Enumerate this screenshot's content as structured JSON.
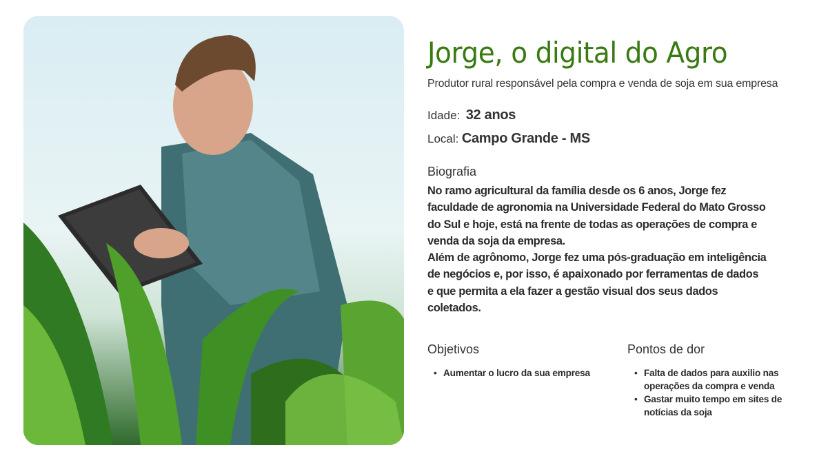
{
  "persona": {
    "title": "Jorge, o digital do Agro",
    "subtitle": "Produtor rural responsável pela compra e venda de soja em sua empresa",
    "age_label": "Idade:",
    "age_value": "32 anos",
    "location_label": "Local:",
    "location_value": "Campo Grande - MS",
    "bio_heading": "Biografia",
    "bio_lines": [
      "No ramo agricultural da família desde os 6 anos, Jorge fez",
      "faculdade de agronomia na Universidade Federal do Mato Grosso",
      "do Sul e hoje, está na frente de todas as operações de compra e",
      "venda da soja da empresa.",
      "Além de agrônomo, Jorge fez uma pós-graduação em inteligência",
      "de negócios e, por isso, é apaixonado por ferramentas de dados",
      "e que permita a ela fazer a gestão visual dos seus dados",
      "coletados."
    ],
    "goals_heading": "Objetivos",
    "goals": [
      "Aumentar o lucro da sua empresa"
    ],
    "pains_heading": "Pontos de dor",
    "pains": [
      "Falta de dados para auxilio nas operações da compra e venda",
      "Gastar muito tempo em sites de notícias da soja"
    ]
  },
  "colors": {
    "title": "#3a7a12"
  }
}
